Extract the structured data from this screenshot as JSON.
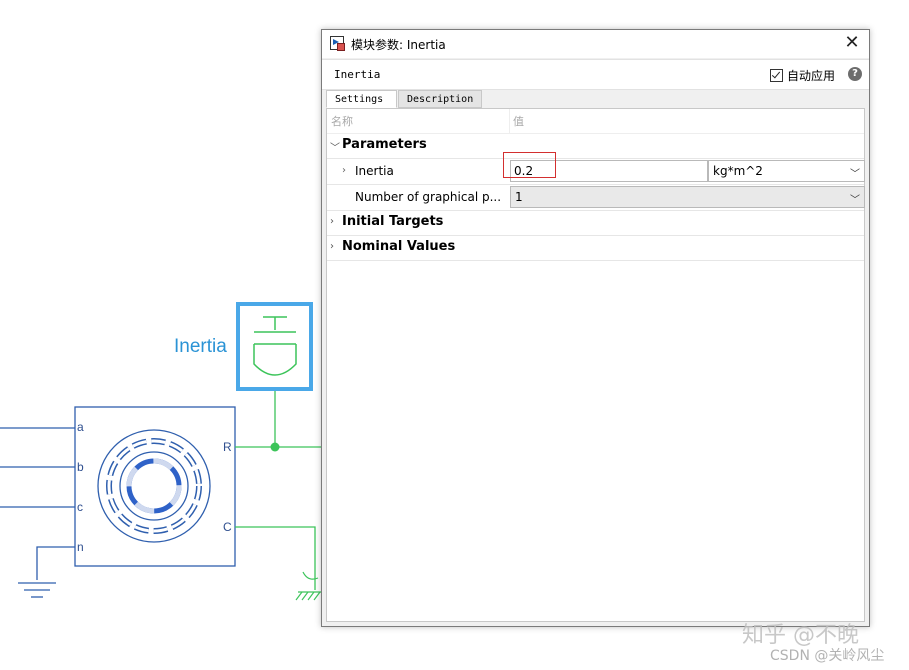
{
  "dialog": {
    "title": "模块参数: Inertia",
    "block_name": "Inertia",
    "auto_apply_label": "自动应用",
    "auto_apply_checked": true,
    "help_label": "?",
    "tabs": [
      {
        "label": "Settings",
        "active": true
      },
      {
        "label": "Description",
        "active": false
      }
    ],
    "columns": {
      "name": "名称",
      "value": "值"
    },
    "groups": {
      "parameters": "Parameters",
      "initial_targets": "Initial Targets",
      "nominal_values": "Nominal Values"
    },
    "params": {
      "inertia_label": "Inertia",
      "inertia_value": "0.2",
      "inertia_unit": "kg*m^2",
      "graphical_ports_label": "Number of graphical p...",
      "graphical_ports_value": "1"
    }
  },
  "diagram": {
    "block_label": "Inertia",
    "motor_ports": [
      "a",
      "b",
      "c",
      "n"
    ],
    "motor_right_ports": [
      "R",
      "C"
    ],
    "line_color": "#2f4f8f",
    "mech_color": "#3cc45a",
    "highlight_color": "#4aa8e8"
  },
  "watermark": {
    "line1": "知乎 @不晚",
    "line2": "CSDN @关岭风尘"
  }
}
